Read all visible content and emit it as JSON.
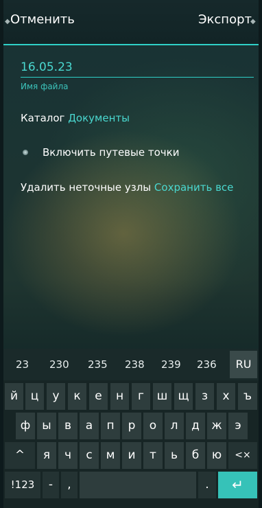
{
  "header": {
    "cancel_label": "Отменить",
    "export_label": "Экспорт"
  },
  "form": {
    "filename_value": "16.05.23",
    "filename_label": "Имя файла",
    "catalog_label": "Каталог",
    "catalog_value": "Документы",
    "waypoints_label": "Включить путевые точки",
    "remove_nodes_label": "Удалить неточные узлы",
    "remove_nodes_value": "Сохранить все"
  },
  "keyboard": {
    "suggestions": [
      "23",
      "230",
      "235",
      "238",
      "239",
      "236"
    ],
    "lang_label": "RU",
    "row1": [
      "й",
      "ц",
      "у",
      "к",
      "е",
      "н",
      "г",
      "ш",
      "щ",
      "з",
      "х",
      "ъ"
    ],
    "row2": [
      "ф",
      "ы",
      "в",
      "а",
      "п",
      "р",
      "о",
      "л",
      "д",
      "ж",
      "э"
    ],
    "row3": [
      "я",
      "ч",
      "с",
      "м",
      "и",
      "т",
      "ь",
      "б",
      "ю"
    ],
    "shift_glyph": "^",
    "backspace_glyph": "<×",
    "numbers_label": "!123",
    "dash_label": "-",
    "comma_label": ",",
    "period_label": ".",
    "enter_glyph": "↵"
  },
  "colors": {
    "accent": "#4ad8d0",
    "enter_key": "#36c2b8"
  }
}
